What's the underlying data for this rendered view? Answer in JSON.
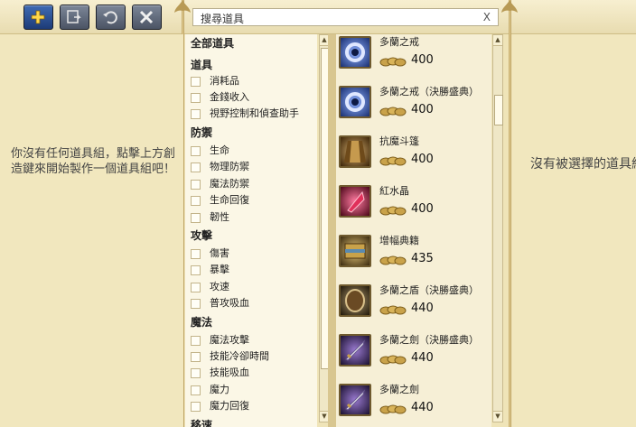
{
  "toolbar": {
    "buttons": [
      {
        "name": "add-icon"
      },
      {
        "name": "export-icon"
      },
      {
        "name": "undo-icon"
      },
      {
        "name": "delete-icon"
      }
    ]
  },
  "search": {
    "value": "搜尋道具",
    "clear_label": "X"
  },
  "left_panel": {
    "empty_message": "你沒有任何道具組，點擊上方創造鍵來開始製作一個道具組吧！"
  },
  "filters": {
    "all_label": "全部道具",
    "groups": [
      {
        "title": "道具",
        "options": [
          "消耗品",
          "金錢收入",
          "視野控制和偵查助手"
        ]
      },
      {
        "title": "防禦",
        "options": [
          "生命",
          "物理防禦",
          "魔法防禦",
          "生命回復",
          "韌性"
        ]
      },
      {
        "title": "攻擊",
        "options": [
          "傷害",
          "暴擊",
          "攻速",
          "普攻吸血"
        ]
      },
      {
        "title": "魔法",
        "options": [
          "魔法攻擊",
          "技能冷卻時間",
          "技能吸血",
          "魔力",
          "魔力回復"
        ]
      },
      {
        "title": "移速",
        "options": []
      }
    ]
  },
  "items": [
    {
      "name": "多蘭之戒",
      "price": "400",
      "icon": "ring-icon",
      "color": "#2b4aa0"
    },
    {
      "name": "多蘭之戒（決勝盛典）",
      "price": "400",
      "icon": "ring-icon",
      "color": "#2b4aa0"
    },
    {
      "name": "抗魔斗篷",
      "price": "400",
      "icon": "cloak-icon",
      "color": "#6b4a1e"
    },
    {
      "name": "紅水晶",
      "price": "400",
      "icon": "crystal-icon",
      "color": "#b0163a"
    },
    {
      "name": "增幅典籍",
      "price": "435",
      "icon": "tome-icon",
      "color": "#8a6a28"
    },
    {
      "name": "多蘭之盾（決勝盛典）",
      "price": "440",
      "icon": "shield-icon",
      "color": "#4a3a22"
    },
    {
      "name": "多蘭之劍（決勝盛典）",
      "price": "440",
      "icon": "sword-icon",
      "color": "#3a2a5a"
    },
    {
      "name": "多蘭之劍",
      "price": "440",
      "icon": "sword-icon",
      "color": "#3a2a5a"
    }
  ],
  "right_panel": {
    "empty_message": "沒有被選擇的道具組"
  },
  "colors": {
    "accent": "#1d3b77",
    "gold": "#b89a55",
    "panel": "#f1e7be"
  }
}
